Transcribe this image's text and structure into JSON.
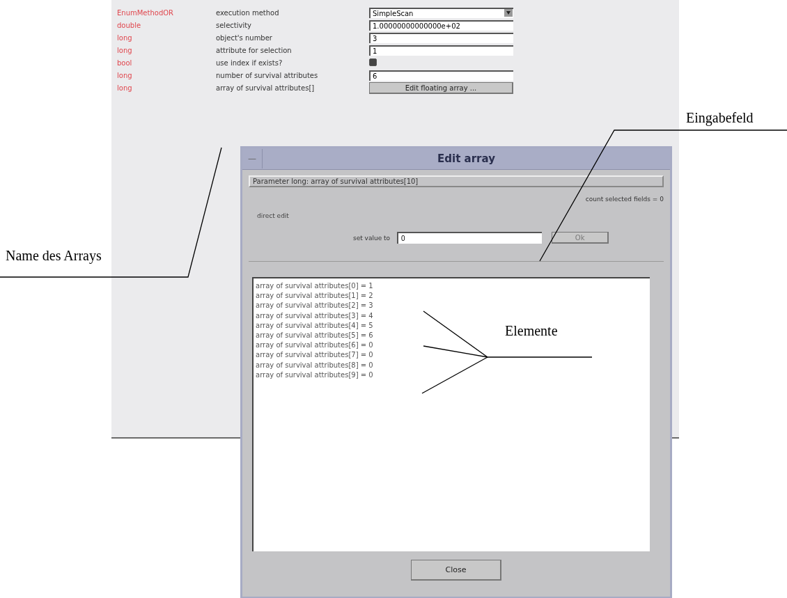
{
  "parameters": [
    {
      "type": "EnumMethodOR",
      "name": "execution method",
      "kind": "dropdown",
      "value": "SimpleScan"
    },
    {
      "type": "double",
      "name": "selectivity",
      "kind": "text",
      "value": "1.00000000000000e+02"
    },
    {
      "type": "long",
      "name": "object's number",
      "kind": "text",
      "value": "3"
    },
    {
      "type": "long",
      "name": "attribute for selection",
      "kind": "text",
      "value": "1"
    },
    {
      "type": "bool",
      "name": "use index if exists?",
      "kind": "checkbox",
      "checked": true
    },
    {
      "type": "long",
      "name": "number of survival attributes",
      "kind": "text",
      "value": "6"
    },
    {
      "type": "long",
      "name": "array of survival attributes[]",
      "kind": "button",
      "label": "Edit floating array ..."
    }
  ],
  "dialog": {
    "title": "Edit array",
    "minimize": "—",
    "header": "Parameter long: array of survival attributes[10]",
    "count": "count selected fields = 0",
    "direct_edit": {
      "legend": "direct edit",
      "label": "set value to",
      "value": "0",
      "button": {
        "label": "Ok",
        "disabled": true
      }
    },
    "items": [
      "array of survival attributes[0] = 1",
      "array of survival attributes[1] = 2",
      "array of survival attributes[2] = 3",
      "array of survival attributes[3] = 4",
      "array of survival attributes[4] = 5",
      "array of survival attributes[5] = 6",
      "array of survival attributes[6] = 0",
      "array of survival attributes[7] = 0",
      "array of survival attributes[8] = 0",
      "array of survival attributes[9] = 0"
    ],
    "close": "Close"
  },
  "annotations": [
    "Eingabefeld",
    "Name des Arrays",
    "Elemente"
  ]
}
